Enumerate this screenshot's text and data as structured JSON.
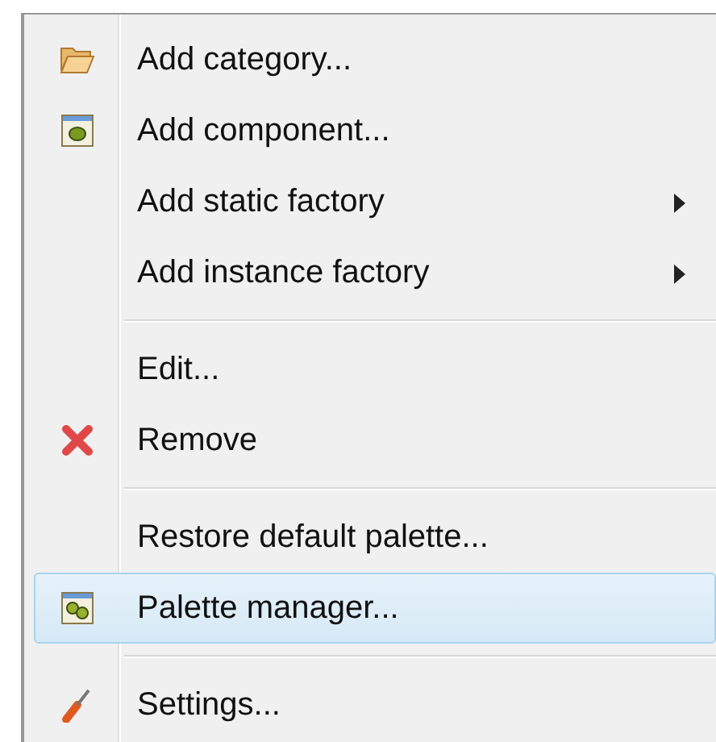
{
  "menu": {
    "items": [
      {
        "kind": "folder",
        "label": "Add category...",
        "selected": false
      },
      {
        "kind": "component",
        "label": "Add component...",
        "selected": false
      },
      {
        "kind": "submenu",
        "label": "Add static factory",
        "selected": false
      },
      {
        "kind": "submenu",
        "label": "Add instance factory",
        "selected": false
      },
      {
        "kind": "separator"
      },
      {
        "kind": "plain",
        "label": "Edit...",
        "selected": false
      },
      {
        "kind": "remove",
        "label": "Remove",
        "selected": false
      },
      {
        "kind": "separator"
      },
      {
        "kind": "plain",
        "label": "Restore default palette...",
        "selected": false
      },
      {
        "kind": "palette",
        "label": "Palette manager...",
        "selected": true
      },
      {
        "kind": "separator"
      },
      {
        "kind": "settings",
        "label": "Settings...",
        "selected": false
      }
    ]
  }
}
